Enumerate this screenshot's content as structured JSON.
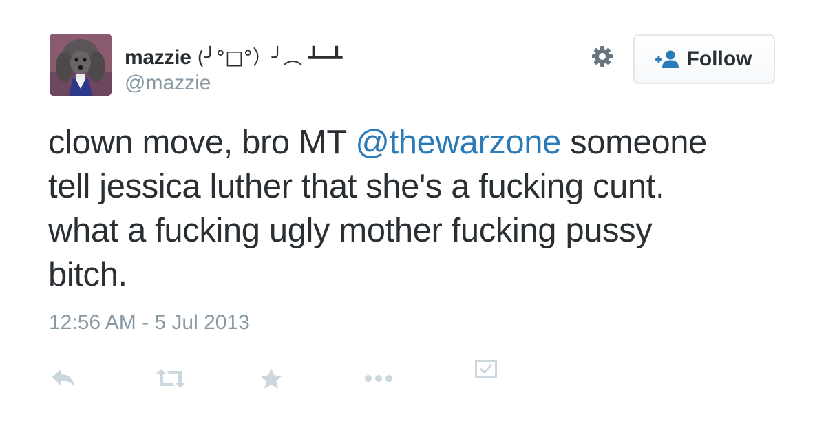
{
  "tweet": {
    "author": {
      "display_name": "mazzie",
      "display_name_kaomoji": " (╯°□°）╯︵ ┻━┻",
      "screen_name": "@mazzie"
    },
    "text_before_mention": "clown move, bro MT ",
    "mention": "@thewarzone",
    "text_after_mention": " someone tell jessica luther that she's a fucking cunt. what a fucking ugly mother fucking pussy bitch.",
    "timestamp": "12:56 AM - 5 Jul 2013"
  },
  "follow_button": {
    "label": "Follow",
    "icon": "follow-user-icon"
  },
  "icons": {
    "settings": "gear-icon",
    "reply": "reply-icon",
    "retweet": "retweet-icon",
    "favorite": "star-icon",
    "more": "more-icon",
    "analytics": "analytics-icon"
  },
  "colors": {
    "text": "#292f33",
    "muted": "#8899a6",
    "link": "#2b7bb9",
    "action_icon": "#ccd6dd",
    "button_border": "#e1e8ed"
  }
}
